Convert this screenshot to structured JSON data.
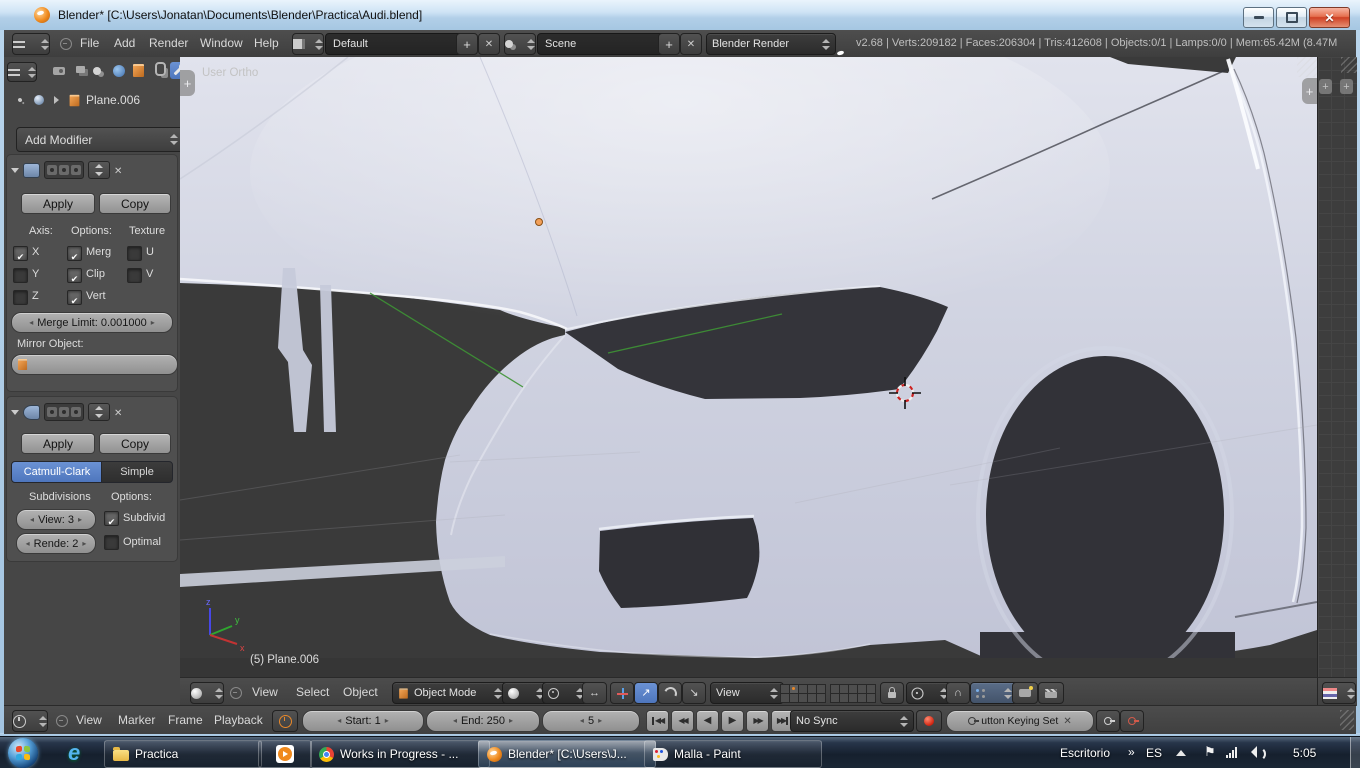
{
  "colors": {
    "accent_blue": "#5680c2",
    "viewport_bg": "#3a3a3a",
    "header_bg": "#454545",
    "panel_bg": "#464646",
    "car_body": "#d2d5e2",
    "select_orange": "#e8882a"
  },
  "window": {
    "title": "Blender* [C:\\Users\\Jonatan\\Documents\\Blender\\Practica\\Audi.blend]"
  },
  "infobar": {
    "menus": [
      "File",
      "Add",
      "Render",
      "Window",
      "Help"
    ],
    "layout_value": "Default",
    "scene_value": "Scene",
    "engine_value": "Blender Render",
    "stats": "v2.68 | Verts:209182 | Faces:206304 | Tris:412608 | Objects:0/1 | Lamps:0/0 | Mem:65.42M (8.47M"
  },
  "properties": {
    "breadcrumb_object": "Plane.006",
    "add_modifier_label": "Add Modifier",
    "mirror": {
      "apply_label": "Apply",
      "copy_label": "Copy",
      "axis_label": "Axis:",
      "options_label": "Options:",
      "texture_label": "Texture",
      "axis": [
        {
          "label": "X",
          "on": true
        },
        {
          "label": "Y",
          "on": false
        },
        {
          "label": "Z",
          "on": false
        }
      ],
      "options": [
        {
          "label": "Merg",
          "on": true
        },
        {
          "label": "Clip",
          "on": true
        },
        {
          "label": "Vert",
          "on": true
        }
      ],
      "texture": [
        {
          "label": "U",
          "on": false
        },
        {
          "label": "V",
          "on": false
        }
      ],
      "merge_limit": "Merge Limit: 0.001000",
      "mirror_object_label": "Mirror Object:"
    },
    "subsurf": {
      "apply_label": "Apply",
      "copy_label": "Copy",
      "type_left": "Catmull-Clark",
      "type_right": "Simple",
      "subdivisions_label": "Subdivisions",
      "options_label": "Options:",
      "view_value": "View: 3",
      "render_value": "Rende: 2",
      "subdivid": {
        "label": "Subdivid",
        "on": true
      },
      "optimal": {
        "label": "Optimal",
        "on": false
      }
    }
  },
  "viewport": {
    "view_name": "User Ortho",
    "active_object": "(5) Plane.006",
    "axis": {
      "x": "x",
      "y": "y",
      "z": "z"
    },
    "header": {
      "menus": [
        "View",
        "Select",
        "Object"
      ],
      "mode_value": "Object Mode",
      "orientation_value": "View"
    }
  },
  "timeline": {
    "menus": [
      "View",
      "Marker",
      "Frame",
      "Playback"
    ],
    "start_value": "Start: 1",
    "end_value": "End: 250",
    "frame_value": "5",
    "sync_value": "No Sync",
    "keying_set_value": "utton Keying Set"
  },
  "taskbar": {
    "buttons": [
      {
        "label": "Practica"
      },
      {
        "label": "Works in Progress - ..."
      },
      {
        "label": "Blender* [C:\\Users\\J..."
      },
      {
        "label": "Malla - Paint"
      }
    ],
    "tray": {
      "desktop_label": "Escritorio",
      "language": "ES",
      "time": "5:05"
    }
  }
}
